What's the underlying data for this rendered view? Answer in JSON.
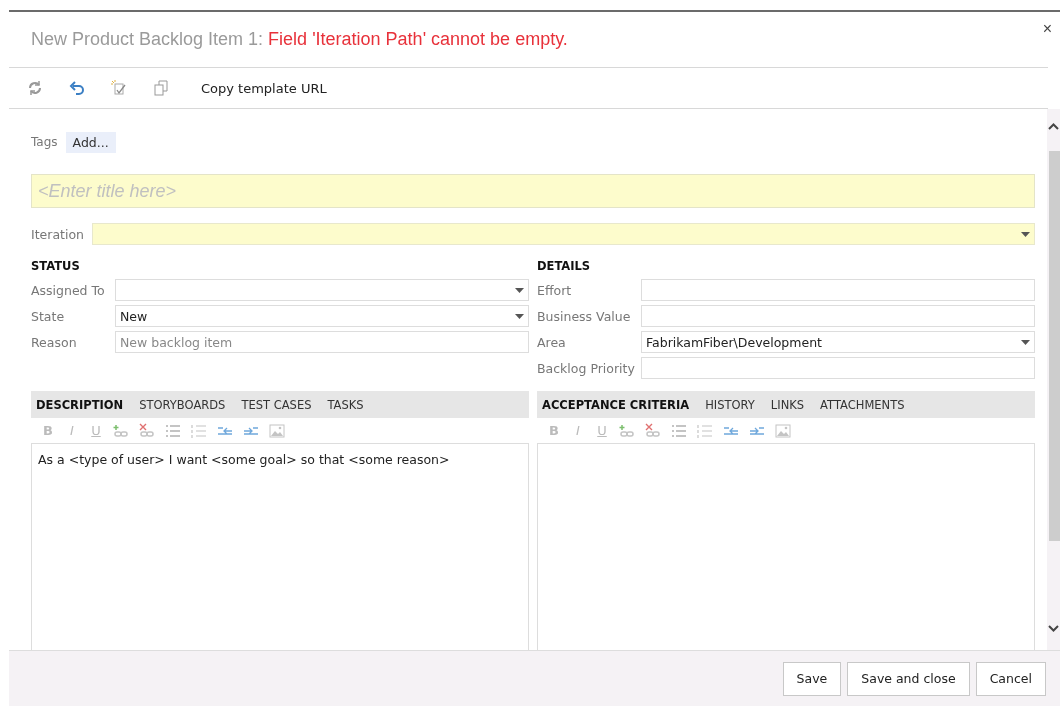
{
  "dialog": {
    "title": "New Product Backlog Item 1:",
    "error": "Field 'Iteration Path' cannot be empty.",
    "close": "×"
  },
  "toolbar": {
    "copy_template_url": "Copy template URL"
  },
  "tags": {
    "label": "Tags",
    "add": "Add..."
  },
  "title_field": {
    "placeholder": "<Enter title here>"
  },
  "iteration": {
    "label": "Iteration"
  },
  "status": {
    "heading": "STATUS",
    "fields": [
      {
        "label": "Assigned To",
        "kind": "dropdown"
      },
      {
        "label": "State",
        "kind": "dropdown",
        "value": "New"
      },
      {
        "label": "Reason",
        "kind": "text",
        "placeholder": "New backlog item"
      }
    ]
  },
  "details": {
    "heading": "DETAILS",
    "fields": [
      {
        "label": "Effort",
        "kind": "text"
      },
      {
        "label": "Business Value",
        "kind": "text"
      },
      {
        "label": "Area",
        "kind": "dropdown",
        "value": "FabrikamFiber\\Development"
      },
      {
        "label": "Backlog Priority",
        "kind": "text"
      }
    ]
  },
  "left_panel": {
    "tabs": [
      {
        "label": "DESCRIPTION",
        "selected": true
      },
      {
        "label": "STORYBOARDS",
        "selected": false
      },
      {
        "label": "TEST CASES",
        "selected": false
      },
      {
        "label": "TASKS",
        "selected": false
      }
    ],
    "format_buttons": [
      "B",
      "I",
      "U"
    ],
    "text": "As a <type of user> I want <some goal> so that <some reason>"
  },
  "right_panel": {
    "tabs": [
      {
        "label": "ACCEPTANCE CRITERIA",
        "selected": true
      },
      {
        "label": "HISTORY",
        "selected": false
      },
      {
        "label": "LINKS",
        "selected": false
      },
      {
        "label": "ATTACHMENTS",
        "selected": false
      }
    ],
    "format_buttons": [
      "B",
      "I",
      "U"
    ]
  },
  "buttons": [
    "Save",
    "Save and close",
    "Cancel"
  ]
}
